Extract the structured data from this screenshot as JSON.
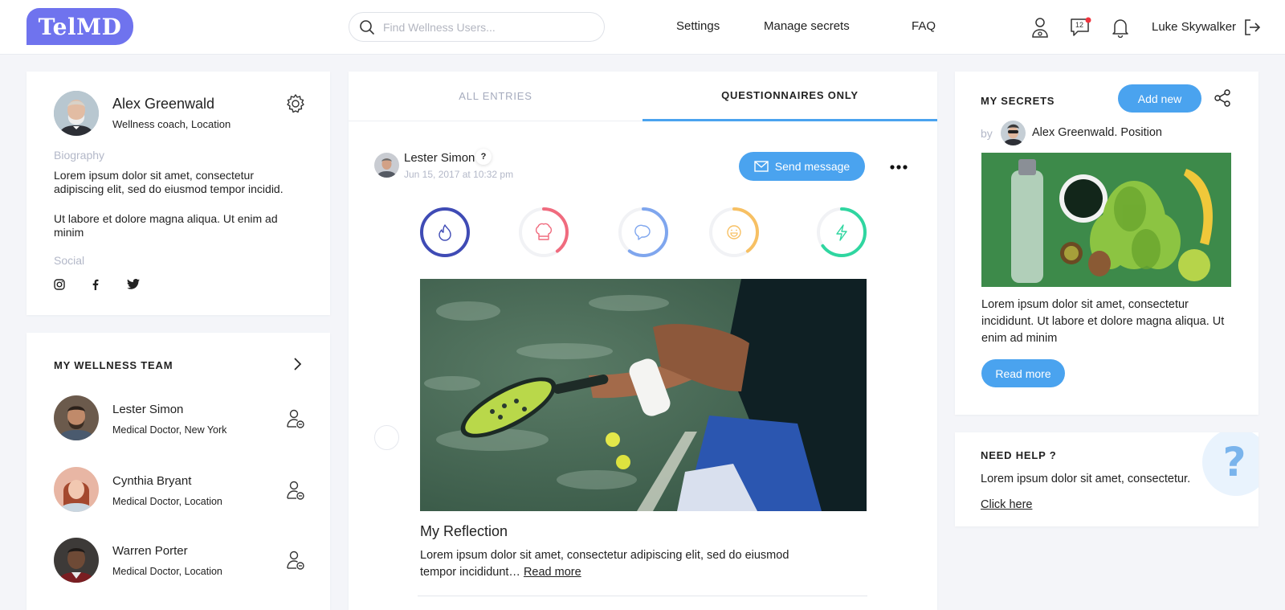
{
  "header": {
    "logo": "TelMD",
    "search_placeholder": "Find Wellness Users...",
    "nav": {
      "settings": "Settings",
      "manage_secrets": "Manage secrets",
      "faq": "FAQ"
    },
    "icons": [
      "doctor-icon",
      "chat-icon",
      "bell-icon",
      "logout-icon"
    ],
    "chat_count": "12",
    "user_name": "Luke Skywalker",
    "accent": "#4aa3ef",
    "brand": "#6f73ee"
  },
  "profile": {
    "name": "Alex Greenwald",
    "role": "Wellness coach, Location",
    "biography_label": "Biography",
    "bio_1": "Lorem ipsum dolor sit amet, consectetur adipiscing elit, sed do eiusmod tempor incidid.",
    "bio_2": "Ut labore et dolore magna aliqua. Ut enim ad minim",
    "social_label": "Social",
    "social_icons": [
      "instagram-icon",
      "facebook-icon",
      "twitter-icon"
    ]
  },
  "team": {
    "title": "MY WELLNESS TEAM",
    "members": [
      {
        "name": "Lester Simon",
        "role": "Medical Doctor, New York"
      },
      {
        "name": "Cynthia Bryant",
        "role": "Medical Doctor, Location"
      },
      {
        "name": "Warren Porter",
        "role": "Medical Doctor, Location"
      }
    ]
  },
  "feed": {
    "tabs": [
      {
        "label": "ALL ENTRIES",
        "active": false
      },
      {
        "label": "QUESTIONNAIRES ONLY",
        "active": true
      }
    ],
    "post": {
      "author": "Lester Simon",
      "badge": "?",
      "date": "Jun 15, 2017 at 10:32 pm",
      "send_label": "Send message",
      "rings": [
        {
          "icon": "flame-icon",
          "color": "#3f4bb5",
          "fraction": 1.0
        },
        {
          "icon": "chef-hat-icon",
          "color": "#f06b7e",
          "fraction": 0.4
        },
        {
          "icon": "speech-icon",
          "color": "#7fa6ee",
          "fraction": 0.6
        },
        {
          "icon": "smile-icon",
          "color": "#f7c063",
          "fraction": 0.4
        },
        {
          "icon": "bolt-icon",
          "color": "#2fd6a0",
          "fraction": 0.65
        }
      ],
      "title": "My Reflection",
      "excerpt": "Lorem ipsum dolor sit amet, consectetur adipiscing elit, sed do eiusmod tempor incididunt…",
      "read_more": "Read more"
    }
  },
  "secrets": {
    "title": "MY SECRETS",
    "add_label": "Add new",
    "by": "by",
    "author": "Alex Greenwald. Position",
    "text": "Lorem ipsum dolor sit amet, consectetur incididunt. Ut labore et dolore magna aliqua. Ut enim ad minim",
    "read_more": "Read more"
  },
  "help": {
    "title": "NEED HELP ?",
    "text": "Lorem ipsum dolor sit amet, consectetur.",
    "link": "Click here",
    "mark": "?"
  }
}
